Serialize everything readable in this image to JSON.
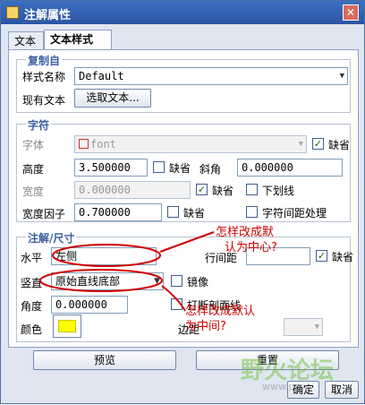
{
  "window": {
    "title": "注解属性",
    "close_glyph": "✕"
  },
  "tabs": [
    {
      "label": "文本"
    },
    {
      "label": "文本样式"
    }
  ],
  "copy_from": {
    "title": "复制自",
    "style_name_label": "样式名称",
    "style_name_value": "Default",
    "existing_text_label": "现有文本",
    "select_text_button": "选取文本..."
  },
  "character": {
    "title": "字符",
    "font_label": "字体",
    "font_value": "font",
    "font_default_label": "缺省",
    "height_label": "高度",
    "height_value": "3.500000",
    "height_default_label": "缺省",
    "slant_label": "斜角",
    "slant_value": "0.000000",
    "width_label": "宽度",
    "width_value": "0.000000",
    "width_default_label": "缺省",
    "underline_label": "下划线",
    "width_factor_label": "宽度因子",
    "width_factor_value": "0.700000",
    "width_factor_default_label": "缺省",
    "char_spacing_label": "字符间距处理"
  },
  "note_size": {
    "title": "注解/尺寸",
    "horizontal_label": "水平",
    "horizontal_value": "左侧",
    "line_spacing_label": "行间距",
    "line_spacing_default_label": "缺省",
    "vertical_label": "竖直",
    "vertical_value": "原始直线底部",
    "mirror_label": "镜像",
    "angle_label": "角度",
    "angle_value": "0.000000",
    "break_hatch_label": "打断剖面线",
    "color_label": "颜色",
    "margin_label": "边距"
  },
  "buttons": {
    "preview": "预览",
    "reset": "重置",
    "ok": "确定",
    "cancel": "取消"
  },
  "annotations": {
    "q1_line1": "怎样改成默",
    "q1_line2": "认为中心?",
    "q2_line1": "怎样改成默认",
    "q2_line2": "为中间?"
  },
  "watermark": {
    "text": "野火论坛",
    "url": "www.pro"
  },
  "colors": {
    "annotation": "#d00000",
    "text_color_swatch": "#ffff00",
    "title_bar": "#2a55a3",
    "group_title": "#3b5fa0"
  },
  "icons": {
    "title": "window-app-icon",
    "font": "font-glyph-icon",
    "dropdown": "chevron-down-icon",
    "check": "checkmark-icon"
  }
}
